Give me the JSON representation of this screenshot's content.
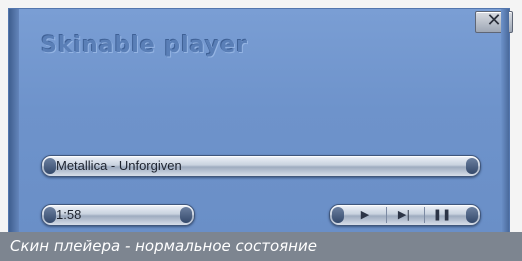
{
  "window": {
    "title": "Skinable player",
    "close_glyph": "✕"
  },
  "track": {
    "label": "Metallica - Unforgiven"
  },
  "time": {
    "value": "1:58"
  },
  "controls": {
    "play_glyph": "▶",
    "next_glyph": "▶|",
    "pause_glyph": "❚❚"
  },
  "caption": {
    "text": "Скин плейера - нормальное состояние"
  },
  "colors": {
    "skin": "#6e93cb",
    "caption_bg": "#7d8590"
  }
}
